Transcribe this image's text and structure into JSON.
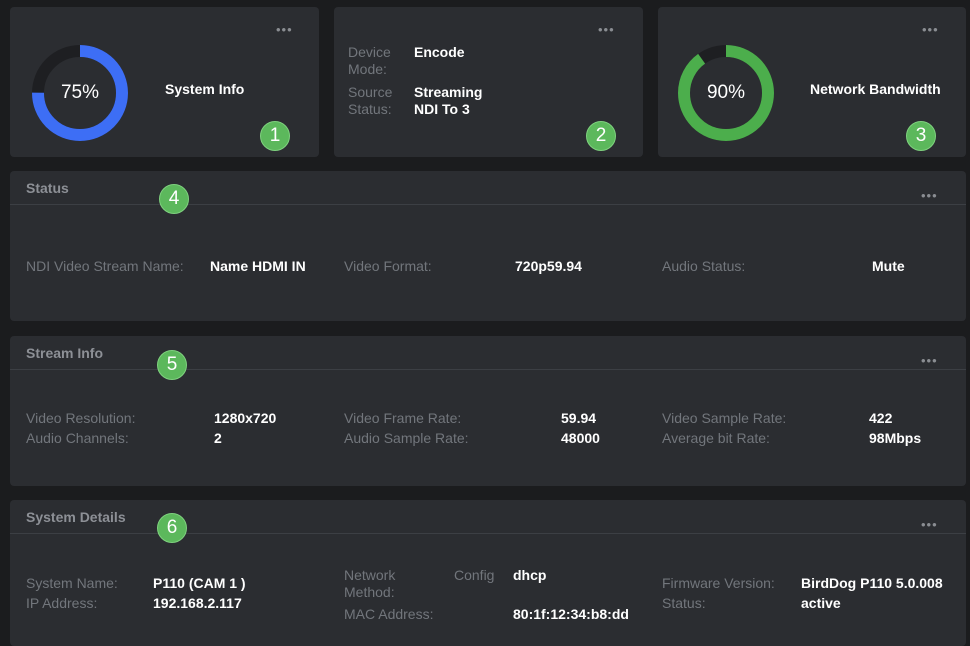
{
  "cards": {
    "system_info": {
      "percent_text": "75%",
      "percent": 0.75,
      "title": "System Info",
      "badge": "1"
    },
    "device": {
      "mode_label": "Device Mode:",
      "mode_value": "Encode",
      "source_label": "Source Status:",
      "source_value_1": "Streaming",
      "source_value_2": "NDI To 3",
      "badge": "2"
    },
    "network": {
      "percent_text": "90%",
      "percent": 0.9,
      "title": "Network Bandwidth",
      "badge": "3"
    },
    "menu": "•••"
  },
  "status": {
    "title": "Status",
    "badge": "4",
    "ndi_label": "NDI Video Stream Name:",
    "ndi_value": "Name HDMI IN",
    "format_label": "Video Format:",
    "format_value": "720p59.94",
    "audio_label": "Audio Status:",
    "audio_value": "Mute"
  },
  "stream_info": {
    "title": "Stream Info",
    "badge": "5",
    "video_res_label": "Video Resolution:",
    "video_res_value": "1280x720",
    "audio_ch_label": "Audio Channels:",
    "audio_ch_value": "2",
    "frame_rate_label": "Video Frame Rate:",
    "frame_rate_value": "59.94",
    "audio_sample_label": "Audio Sample Rate:",
    "audio_sample_value": "48000",
    "video_sample_label": "Video Sample Rate:",
    "video_sample_value": "422",
    "avg_bit_label": "Average bit Rate:",
    "avg_bit_value": "98Mbps"
  },
  "system_details": {
    "title": "System Details",
    "badge": "6",
    "sys_name_label": "System Name:",
    "sys_name_value": "P110 (CAM 1 )",
    "ip_label": "IP Address:",
    "ip_value": "192.168.2.117",
    "net_label_1": "Network",
    "net_label_2": "Method:",
    "config_label": "Config",
    "config_value": "dhcp",
    "mac_label": "MAC Address:",
    "mac_value": "80:1f:12:34:b8:dd",
    "fw_label": "Firmware Version:",
    "fw_value": "BirdDog P110 5.0.008",
    "status_label": "Status:",
    "status_value": "active"
  },
  "colors": {
    "system_gauge": "#3d6ef5",
    "network_gauge": "#4cae4c",
    "gauge_track": "#1e1f22",
    "badge": "#5cb85c"
  }
}
